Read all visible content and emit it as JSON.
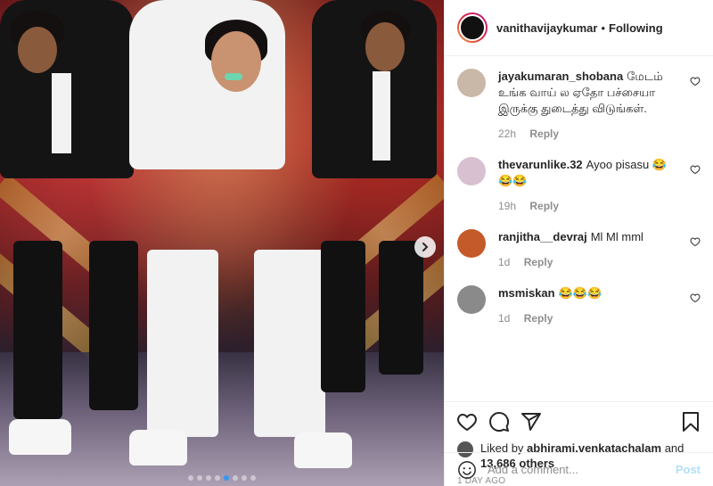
{
  "header": {
    "username": "vanithavijaykumar",
    "separator": "•",
    "follow_status": "Following"
  },
  "comments": [
    {
      "user": "jayakumaran_shobana",
      "text": "மேடம் உங்க வாய் ல ஏதோ பச்சையா இருக்கு துடைத்து விடுங்கள்.",
      "time": "22h",
      "reply": "Reply",
      "avatar_color": "#c9b8a8"
    },
    {
      "user": "thevarunlike.32",
      "text": "Ayoo pisasu 😂 😂😂",
      "time": "19h",
      "reply": "Reply",
      "avatar_color": "#d8c0d0"
    },
    {
      "user": "ranjitha__devraj",
      "text": "Ml Ml mml",
      "time": "1d",
      "reply": "Reply",
      "avatar_color": "#c45a2a"
    },
    {
      "user": "msmiskan",
      "text": "😂😂😂",
      "time": "1d",
      "reply": "Reply",
      "avatar_color": "#8a8a8a"
    }
  ],
  "likes": {
    "prefix": "Liked by ",
    "user": "abhirami.venkatachalam",
    "middle": " and",
    "count": "13,686 others"
  },
  "timestamp": "1 DAY AGO",
  "add_comment": {
    "placeholder": "Add a comment...",
    "post_label": "Post"
  },
  "carousel": {
    "dot_count": 8,
    "active_index": 4
  },
  "colors": {
    "accent": "#3897f0",
    "post_disabled": "#b2dffc",
    "muted": "#8e8e8e"
  }
}
